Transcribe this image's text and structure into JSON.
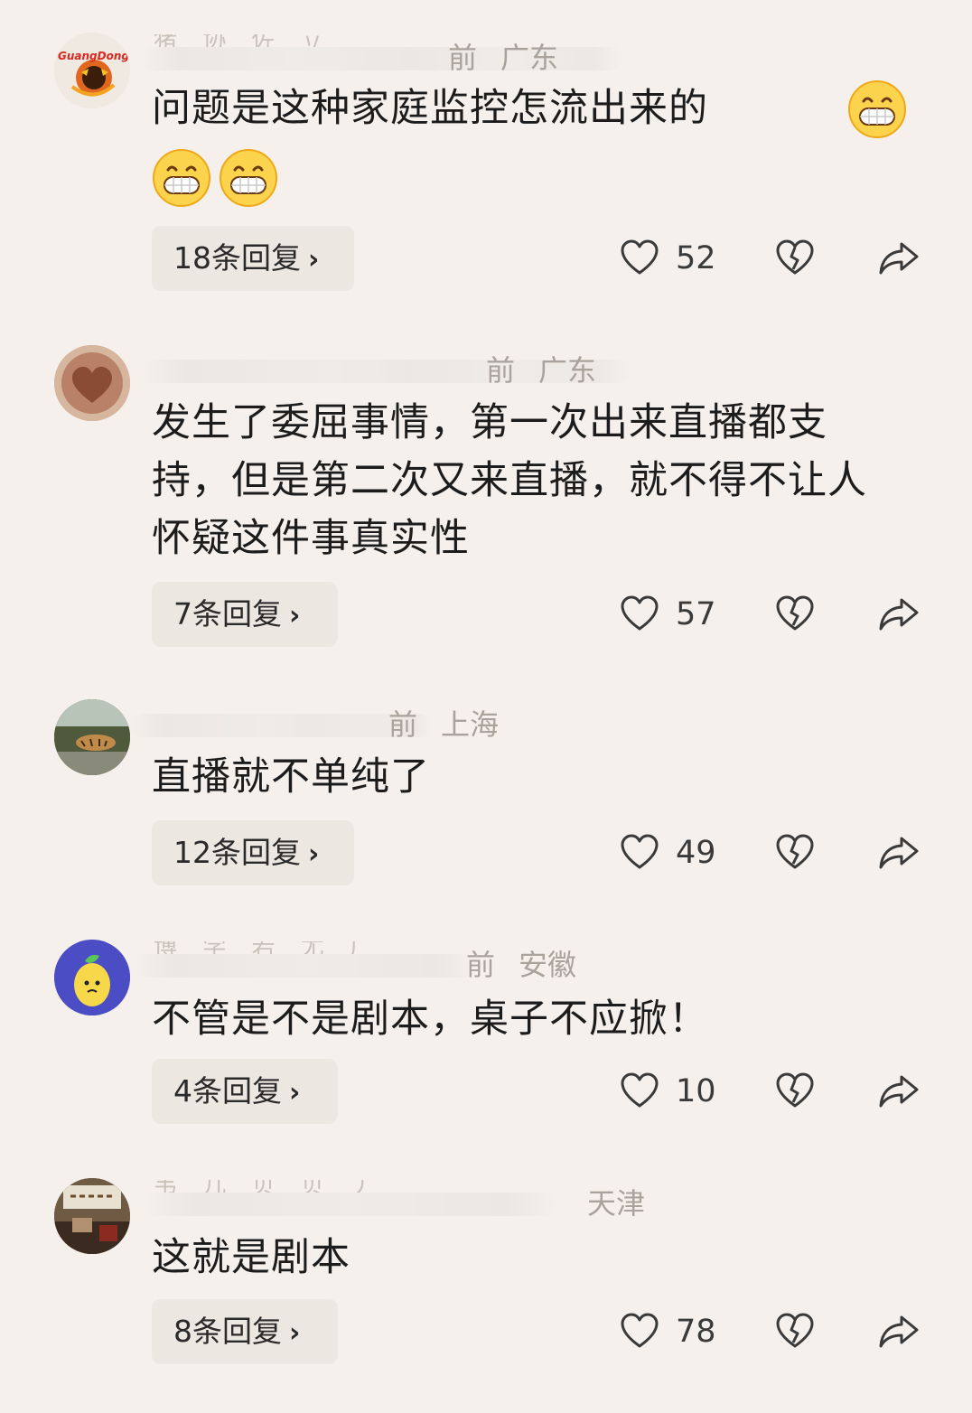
{
  "comments": [
    {
      "time": "前",
      "location": "广东",
      "text": "问题是这种家庭监控怎流出来的",
      "emojis": [
        "grinning-face-emoji",
        "grinning-face-emoji",
        "grinning-face-emoji"
      ],
      "replies": "18条回复",
      "likes": "52",
      "avatar_text": "GuangDong"
    },
    {
      "time": "前",
      "location": "广东",
      "text": "发生了委屈事情，第一次出来直播都支持，但是第二次又来直播，就不得不让人怀疑这件事真实性",
      "replies": "7条回复",
      "likes": "57"
    },
    {
      "time": "前",
      "location": "上海",
      "text": "直播就不单纯了",
      "replies": "12条回复",
      "likes": "49"
    },
    {
      "time": "前",
      "location": "安徽",
      "text": "不管是不是剧本，桌子不应掀！",
      "replies": "4条回复",
      "likes": "10"
    },
    {
      "time": "",
      "location": "天津",
      "text": "这就是剧本",
      "replies": "8条回复",
      "likes": "78"
    }
  ],
  "colors": {
    "background": "#f5f0eb",
    "reply_pill": "#ede7e1",
    "meta_text": "#aaa39c",
    "icon_stroke": "#3a3a3a"
  }
}
